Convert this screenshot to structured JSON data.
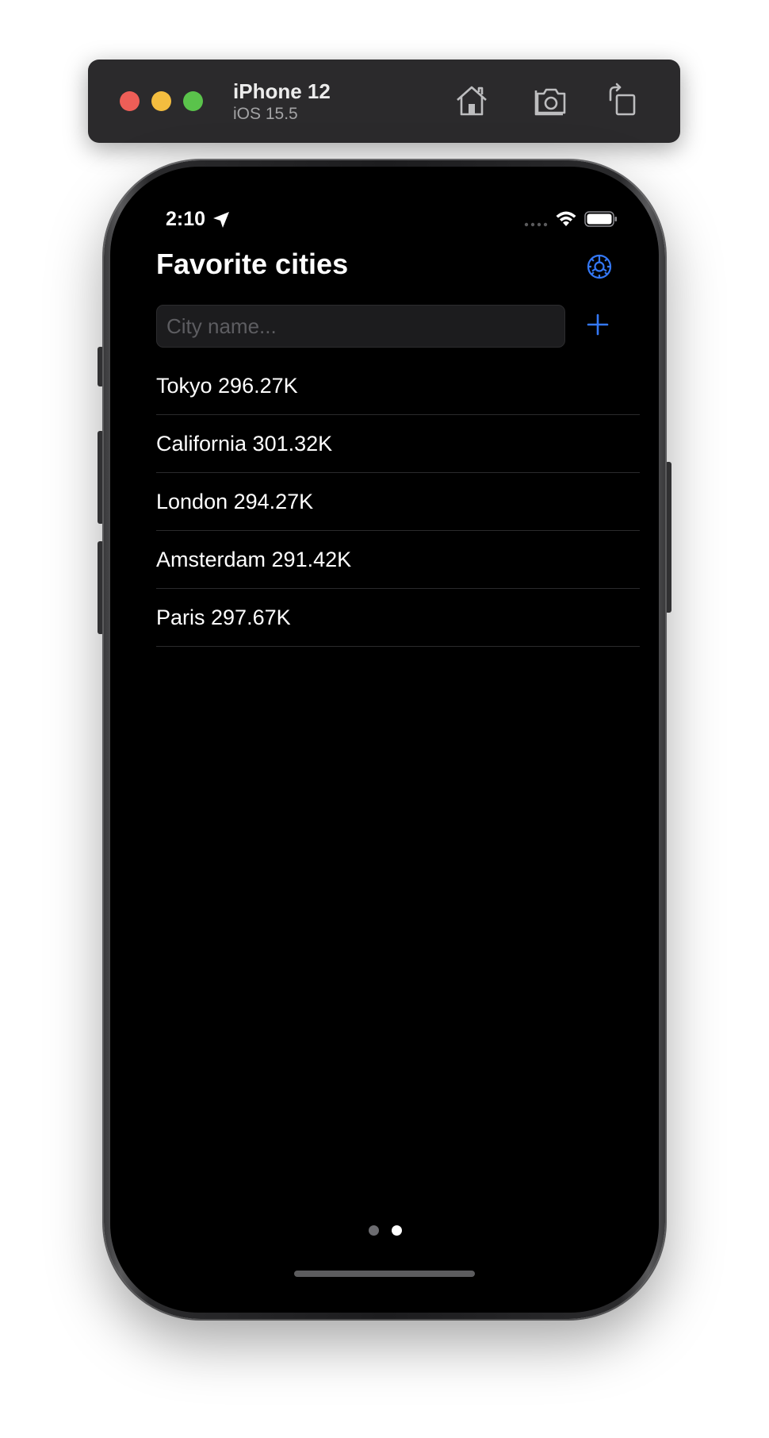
{
  "simulator": {
    "device_name": "iPhone 12",
    "os_version": "iOS 15.5",
    "icons": [
      "home-icon",
      "screenshot-icon",
      "rotate-icon"
    ]
  },
  "status_bar": {
    "time": "2:10"
  },
  "app": {
    "title": "Favorite cities",
    "search": {
      "placeholder": "City name...",
      "value": ""
    },
    "cities": [
      {
        "label": "Tokyo 296.27K"
      },
      {
        "label": "California 301.32K"
      },
      {
        "label": "London 294.27K"
      },
      {
        "label": "Amsterdam 291.42K"
      },
      {
        "label": "Paris 297.67K"
      }
    ],
    "page_indicator": {
      "pages": 2,
      "current": 2
    }
  },
  "colors": {
    "accent": "#3478f6",
    "background": "#000000",
    "text": "#ffffff",
    "toolbar": "#2b2a2c"
  }
}
